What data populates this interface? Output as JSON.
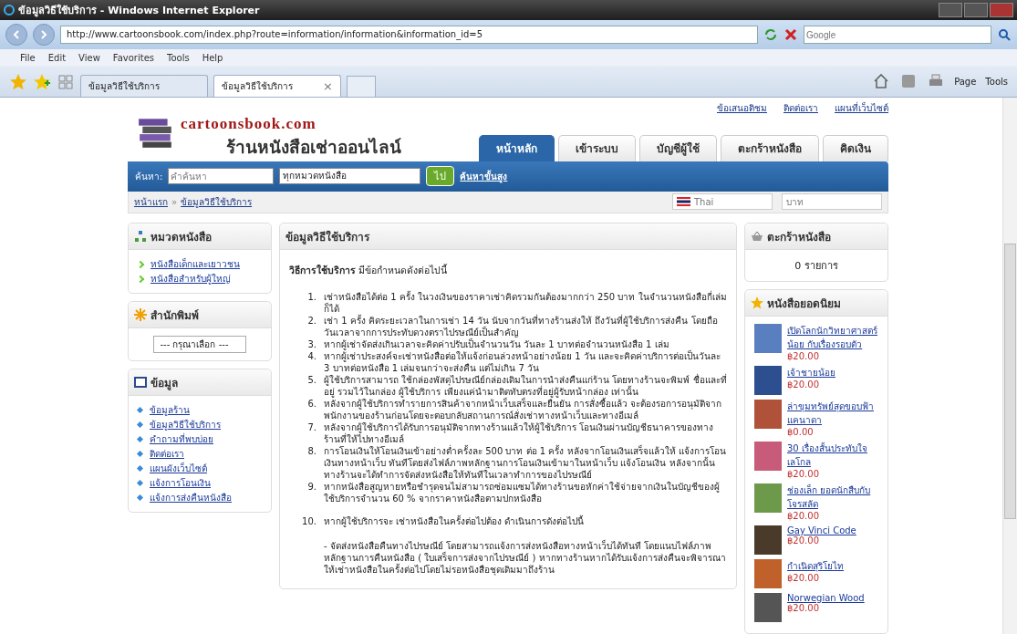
{
  "window": {
    "title": "ข้อมูลวิธีใช้บริการ - Windows Internet Explorer"
  },
  "address_bar": {
    "url": "http://www.cartoonsbook.com/index.php?route=information/information&information_id=5",
    "search_placeholder": "Google"
  },
  "menu": [
    "File",
    "Edit",
    "View",
    "Favorites",
    "Tools",
    "Help"
  ],
  "tabs": [
    {
      "label": "ข้อมูลวิธีใช้บริการ",
      "selected": false
    },
    {
      "label": "ข้อมูลวิธีใช้บริการ",
      "selected": true,
      "close": "×"
    }
  ],
  "command_bar": [
    "Page",
    "Tools"
  ],
  "site": {
    "top_links": [
      "ข้อเสนอติชม",
      "ติดต่อเรา",
      "แผนที่เว็บไซต์"
    ],
    "logo": {
      "name": "cartoonsbook.com",
      "tagline": "ร้านหนังสือเช่าออนไลน์"
    },
    "nav": [
      {
        "label": "หน้าหลัก",
        "selected": true
      },
      {
        "label": "เข้าระบบ",
        "selected": false
      },
      {
        "label": "บัญชีผู้ใช้",
        "selected": false
      },
      {
        "label": "ตะกร้าหนังสือ",
        "selected": false
      },
      {
        "label": "คิดเงิน",
        "selected": false
      }
    ],
    "search": {
      "label": "ค้นหา:",
      "placeholder": "คำค้นหา",
      "category": "ทุกหมวดหนังสือ",
      "button": "ไป",
      "advanced": "ค้นหาขั้นสูง"
    },
    "breadcrumb": [
      "หน้าแรก",
      "»",
      "ข้อมูลวิธีใช้บริการ"
    ],
    "language": "Thai",
    "currency": "บาท"
  },
  "categories": {
    "title": "หมวดหนังสือ",
    "items": [
      "หนังสือเด็กและเยาวชน",
      "หนังสือสำหรับผู้ใหญ่"
    ]
  },
  "publishers": {
    "title": "สำนักพิมพ์",
    "select": "--- กรุณาเลือก ---"
  },
  "information": {
    "title": "ข้อมูล",
    "items": [
      "ข้อมูลร้าน",
      "ข้อมูลวิธีใช้บริการ",
      "คำถามที่พบบ่อย",
      "ติดต่อเรา",
      "แผนผังเว็บไซต์",
      "แจ้งการโอนเงิน",
      "แจ้งการส่งคืนหนังสือ"
    ]
  },
  "content": {
    "title": "ข้อมูลวิธีใช้บริการ",
    "intro": "**วิธีการใช้บริการ** มีข้อกำหนดดังต่อไปนี้",
    "rules": [
      {
        "number": "1.",
        "text": "เช่าหนังสือได้ต่อ 1 ครั้ง ในวงเงินของราคาเช่าคิดรวมกันต้องมากกว่า 250 บาท ในจำนวนหนังสือกี่เล่มก็ได้"
      },
      {
        "number": "2.",
        "text": "เช่า 1 ครั้ง คิดระยะเวลาในการเช่า 14 วัน นับจากวันที่ทางร้านส่งให้ ถึงวันที่ผู้ใช้บริการส่งคืน โดยถือวันเวลาจากการประทับดวงตราไปรษณีย์เป็นสำคัญ"
      },
      {
        "number": "3.",
        "text": "หากผู้เช่าจัดส่งเกินเวลาจะคิดค่าปรับเป็นจำนวนวัน วันละ 1 บาทต่อจำนวนหนังสือ 1 เล่ม"
      },
      {
        "number": "4.",
        "text": "หากผู้เช่าประสงค์จะเช่าหนังสือต่อให้แจ้งก่อนล่วงหน้าอย่างน้อย 1 วัน และจะคิดค่าบริการต่อเป็นวันละ 3 บาทต่อหนังสือ 1 เล่มจนกว่าจะส่งคืน แต่ไม่เกิน 7 วัน"
      },
      {
        "number": "5.",
        "text": "ผู้ใช้บริการสามารถ ใช้กล่องพัสดุไปรษณีย์กล่องเดิมในการนำส่งคืนแก่ร้าน โดยทางร้านจะพิมพ์ ชื่อและที่อยู่ รวมไว้ในกล่อง ผู้ใช้บริการ เพียงแค่นำมาติดทับตรงที่อยู่ผู้รับหน้ากล่อง เท่านั้น"
      },
      {
        "number": "6.",
        "text": "หลังจากผู้ใช้บริการทำรายการสินค้าจากหน้าเว็บเสร็จและยืนยัน การสั่งซื้อแล้ว จะต้องรอการอนุมัติจากพนักงานของร้านก่อนโดยจะตอบกลับสถานการณ์สั่งเช่าทางหน้าเว็บและทางอีเมล์"
      },
      {
        "number": "7.",
        "text": "หลังจากผู้ใช้บริการได้รับการอนุมัติจากทางร้านแล้วให้ผู้ใช้บริการ โอนเงินผ่านบัญชีธนาคารของทางร้านที่ให้ไปทางอีเมล์"
      },
      {
        "number": "8.",
        "text": "การโอนเงินให้โอนเงินเข้าอย่างต่ำครั้งละ 500 บาท ต่อ 1 ครั้ง หลังจากโอนเงินเสร็จแล้วให้ แจ้งการโอนเงินทางหน้าเว็บ ทันทีโดยส่งไฟล์ภาพหลักฐานการโอนเงินเข้ามาในหน้าเว็บ แจ้งโอนเงิน หลังจากนั้นทางร้านจะได้ทำการจัดส่งหนังสือให้ทันทีในเวลาทำการของไปรษณีย์"
      },
      {
        "number": "9.",
        "text": "หากหนังสือสูญหายหรือชำรุดจนไม่สามารถซ่อมแซมได้ทางร้านขอหักค่าใช้จ่ายจากเงินในบัญชีของผู้ใช้บริการจำนวน 60 % จากราคาหนังสือตามปกหนังสือ"
      },
      {
        "number": "10.",
        "text": "หากผู้ใช้บริการจะ เช่าหนังสือในครั้งต่อไปต้อง ดำเนินการดังต่อไปนี้"
      }
    ],
    "note": "- จัดส่งหนังสือคืนทางไปรษณีย์ โดยสามารถแจ้งการส่งหนังสือทางหน้าเว็บได้ทันที โดยแนบไฟล์ภาพหลักฐานการคืนหนังสือ ( ใบเสร็จการส่งจากไปรษณีย์ ) หากทางร้านหากได้รับแจ้งการส่งคืนจะพิจารณาให้เช่าหนังสือในครั้งต่อไปโดยไม่รอหนังสือชุดเดิมมาถึงร้าน"
  },
  "cart": {
    "title": "ตะกร้าหนังสือ",
    "summary": "0 รายการ"
  },
  "popular": {
    "title": "หนังสือยอดนิยม",
    "books": [
      {
        "title": "เปิดโลกนักวิทยาศาสตร์น้อย กับเรื่องรอบตัว",
        "price": "฿20.00"
      },
      {
        "title": "เจ้าชายน้อย",
        "price": "฿20.00"
      },
      {
        "title": "ล่าขุมทรัพย์สุดขอบฟ้าแคนาดา",
        "price": "฿0.00"
      },
      {
        "title": "30 เรื่องสั้นประทับใจ เลโกล",
        "price": "฿20.00"
      },
      {
        "title": "ช่องเล็ก ยอดนักสืบกับโจรสลัด",
        "price": "฿20.00"
      },
      {
        "title": "Gay Vinci Code",
        "price": "฿20.00"
      },
      {
        "title": "กำเนิดสุริโยไท",
        "price": "฿20.00"
      },
      {
        "title": "Norwegian Wood",
        "price": "฿20.00"
      }
    ]
  }
}
